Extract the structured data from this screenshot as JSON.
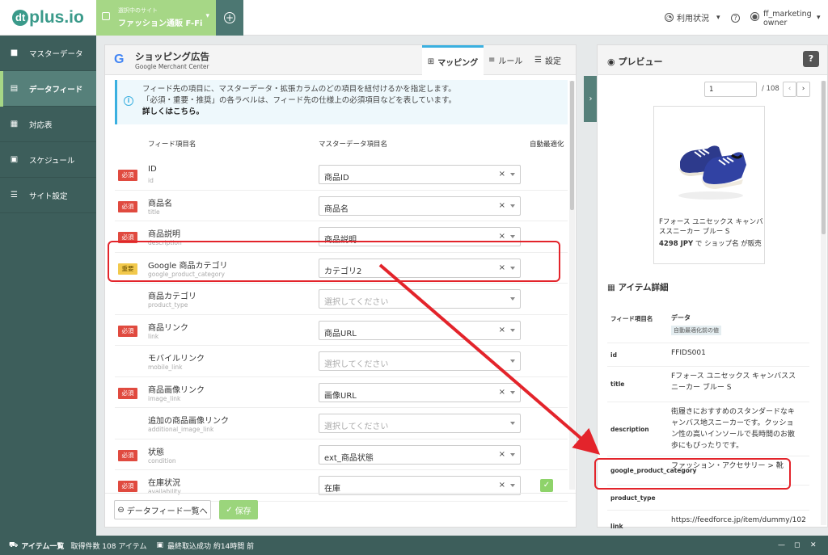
{
  "topbar": {
    "logo_text": "plus.io",
    "logo_mark": "dt",
    "site_caption": "選択中のサイト",
    "site_name": "ファッション通販 F-Fi",
    "usage_label": "利用状況",
    "user_name": "ff_marketing",
    "user_role": "owner"
  },
  "sidebar": {
    "items": [
      {
        "label": "マスターデータ",
        "icon": "folder-icon"
      },
      {
        "label": "データフィード",
        "icon": "document-icon"
      },
      {
        "label": "対応表",
        "icon": "table-icon"
      },
      {
        "label": "スケジュール",
        "icon": "calendar-icon"
      },
      {
        "label": "サイト設定",
        "icon": "sliders-icon"
      }
    ],
    "active": 1
  },
  "main": {
    "title": "ショッピング広告",
    "subtitle": "Google Merchant Center",
    "tabs": [
      "マッピング",
      "ルール",
      "設定"
    ],
    "info_lines": [
      "フィード先の項目に、マスターデータ・拡張カラムのどの項目を紐付けるかを指定します。",
      "「必須・重要・推奨」の各ラベルは、フィード先の仕様上の必須項目などを表しています。"
    ],
    "info_link": "詳しくはこちら。",
    "col_field": "フィード項目名",
    "col_master": "マスターデータ項目名",
    "col_auto": "自動最適化",
    "rows": [
      {
        "badge": "必須",
        "name": "ID",
        "sub": "id",
        "value": "商品ID",
        "placeholder": false
      },
      {
        "badge": "必須",
        "name": "商品名",
        "sub": "title",
        "value": "商品名",
        "placeholder": false
      },
      {
        "badge": "必須",
        "name": "商品説明",
        "sub": "description",
        "value": "商品説明",
        "placeholder": false
      },
      {
        "badge": "重要",
        "name": "Google 商品カテゴリ",
        "sub": "google_product_category",
        "value": "カテゴリ2",
        "placeholder": false
      },
      {
        "badge": "",
        "name": "商品カテゴリ",
        "sub": "product_type",
        "value": "選択してください",
        "placeholder": true
      },
      {
        "badge": "必須",
        "name": "商品リンク",
        "sub": "link",
        "value": "商品URL",
        "placeholder": false
      },
      {
        "badge": "",
        "name": "モバイルリンク",
        "sub": "mobile_link",
        "value": "選択してください",
        "placeholder": true
      },
      {
        "badge": "必須",
        "name": "商品画像リンク",
        "sub": "image_link",
        "value": "画像URL",
        "placeholder": false
      },
      {
        "badge": "",
        "name": "追加の商品画像リンク",
        "sub": "additional_image_link",
        "value": "選択してください",
        "placeholder": true
      },
      {
        "badge": "必須",
        "name": "状態",
        "sub": "condition",
        "value": "ext_商品状態",
        "placeholder": false
      },
      {
        "badge": "必須",
        "name": "在庫状況",
        "sub": "availability",
        "value": "在庫",
        "placeholder": false,
        "auto": true
      }
    ],
    "back_label": "データフィード一覧へ",
    "save_label": "保存"
  },
  "preview": {
    "title": "プレビュー",
    "page_current": "1",
    "page_total": "/ 108",
    "product_name": "Fフォース ユニセックス キャンバススニーカー ブルー S",
    "product_price": "4298 JPY",
    "product_price_suffix": "で ショップ名 が販売",
    "detail_title": "アイテム詳細",
    "detail_col_key": "フィード項目名",
    "detail_col_val": "データ",
    "detail_tag": "自動最適化前の値",
    "details": [
      {
        "key": "id",
        "value": "FFIDS001"
      },
      {
        "key": "title",
        "value": "Fフォース ユニセックス キャンバススニーカー ブルー S"
      },
      {
        "key": "description",
        "value": "街履きにおすすめのスタンダードなキャンバス地スニーカーです。クッション性の高いインソールで長時間のお散歩にもぴったりです。"
      },
      {
        "key": "google_product_category",
        "value": "ファッション・アクセサリー > 靴"
      },
      {
        "key": "product_type",
        "value": ""
      },
      {
        "key": "link",
        "value": "https://feedforce.jp/item/dummy/102"
      }
    ]
  },
  "statusbar": {
    "items_label": "アイテム一覧",
    "count_label": "取得件数 108 アイテム",
    "import_label": "最終取込成功 約14時間 前"
  },
  "colors": {
    "sidebar": "#3d5e5b",
    "accent_green": "#a6d786",
    "required_red": "#e04a3f",
    "important_yellow": "#f2c94c",
    "annotation_red": "#e3242b",
    "tab_blue": "#3ab0e0"
  }
}
